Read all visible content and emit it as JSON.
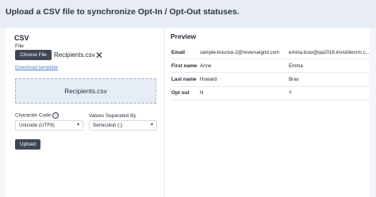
{
  "header": {
    "title": "Upload a CSV file to synchronize Opt-In / Opt-Out statuses."
  },
  "csv": {
    "heading": "CSV",
    "file_label": "File",
    "choose_button": "Choose File",
    "file_name": "Recipients.csv",
    "clear_icon": "close-icon",
    "download_link": "Download template",
    "dropzone_text": "Recipients.csv",
    "char_code_label": "Character Code",
    "char_code_info_icon": "info-icon",
    "char_code_value": "Unicode (UTF8)",
    "separator_label": "Values Separated By",
    "separator_value": "Semicolon (;)",
    "upload_button": "Upload"
  },
  "preview": {
    "heading": "Preview",
    "rows": [
      {
        "label": "Email",
        "v1": "sample-bounce-2@revenuegrid.com",
        "v2": "emma.brax@qa2016.invisiblecrm.c..."
      },
      {
        "label": "First name",
        "v1": "Anne",
        "v2": "Emma"
      },
      {
        "label": "Last name",
        "v1": "Howard",
        "v2": "Brax"
      },
      {
        "label": "Opt out",
        "v1": "N",
        "v2": "Y"
      }
    ]
  },
  "colors": {
    "primary_button": "#3d4652",
    "link": "#4f7fc7",
    "dropzone": "#e6edf6",
    "header_bg": "#e8edf4"
  }
}
